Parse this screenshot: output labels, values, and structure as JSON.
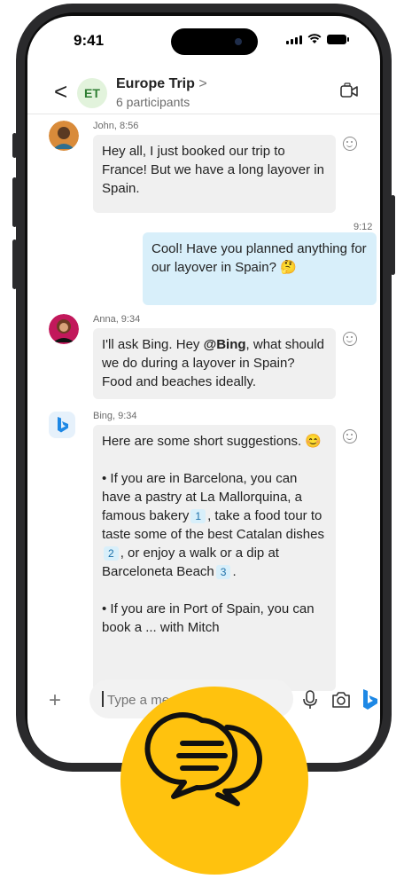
{
  "status_bar": {
    "time": "9:41"
  },
  "header": {
    "initials": "ET",
    "title": "Europe Trip",
    "title_chevron": ">",
    "subtitle": "6 participants",
    "back_glyph": "<"
  },
  "messages": [
    {
      "sender_meta": "John, 8:56",
      "text": "Hey all, I just booked our trip to France! But we have a long layover in Spain."
    },
    {
      "time": "9:12",
      "text": "Cool! Have you planned anything for our layover in Spain?",
      "emoji": "🤔"
    },
    {
      "sender_meta": "Anna, 9:34",
      "text_before": "I'll ask Bing. Hey ",
      "mention": "@Bing",
      "text_after": ", what should we do during a layover in Spain? Food and beaches ideally."
    },
    {
      "sender_meta": "Bing, 9:34",
      "intro": "Here are some short suggestions.",
      "intro_emoji": "😊",
      "p1_a": "• If you are in Barcelona, you can have a pastry at La Mallorquina, a famous bakery",
      "cite1": "1",
      "p1_b": ", take a food tour to taste some of the best Catalan dishes",
      "cite2": "2",
      "p1_c": ", or enjoy a walk or a dip at Barceloneta Beach",
      "cite3": "3",
      "p1_d": ".",
      "p2": "• If you are in Port of Spain, you can book a ... with Mitch"
    }
  ],
  "composer": {
    "placeholder": "Type a message"
  },
  "colors": {
    "badge": "#ffc20e",
    "bing": "#1e88e5",
    "mine_bubble": "#d8effa",
    "other_bubble": "#f0f0f0"
  }
}
